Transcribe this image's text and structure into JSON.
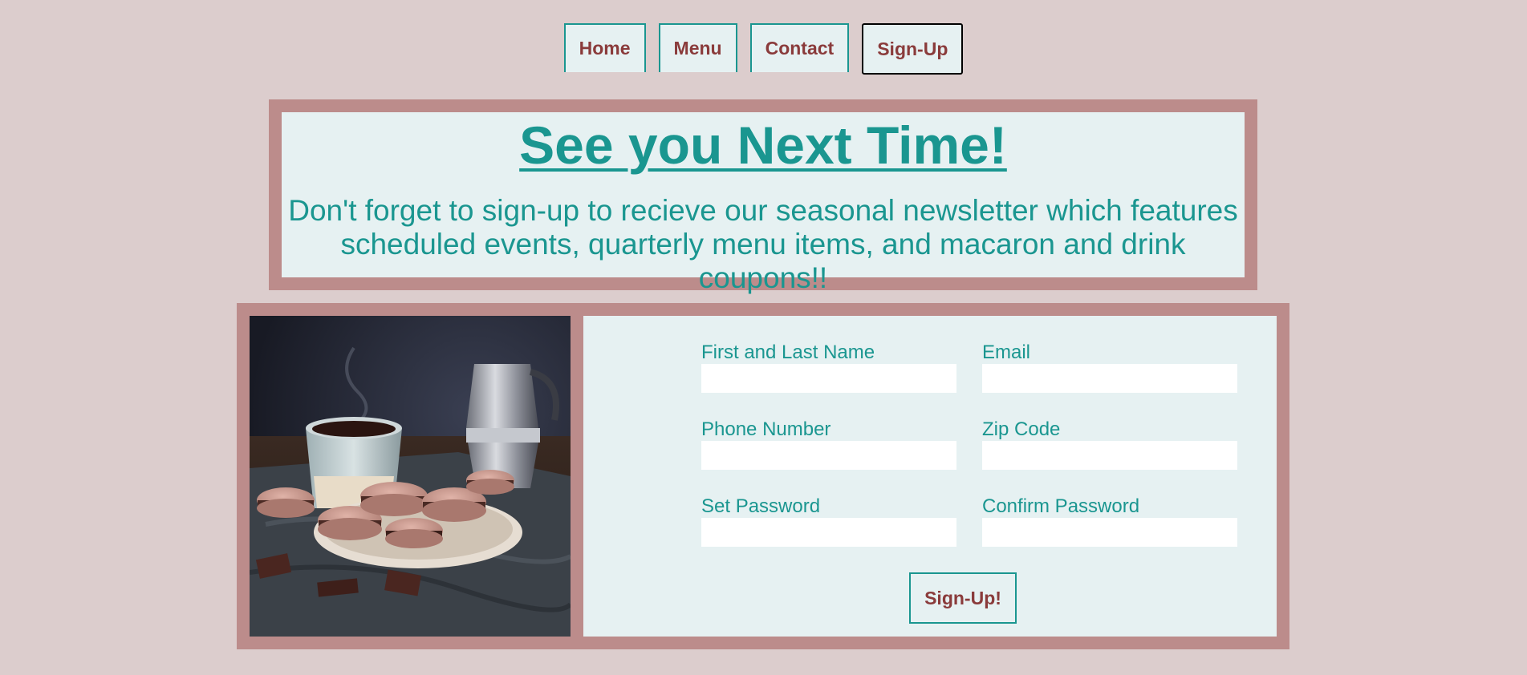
{
  "nav": {
    "items": [
      {
        "label": "Home",
        "active": false
      },
      {
        "label": "Menu",
        "active": false
      },
      {
        "label": "Contact",
        "active": false
      },
      {
        "label": "Sign-Up",
        "active": true
      }
    ]
  },
  "hero": {
    "title": "See you Next Time!",
    "text": "Don't forget to sign-up to recieve our seasonal newsletter which features scheduled events, quarterly menu items, and macaron and drink coupons!!"
  },
  "photo": {
    "icon": "macarons-coffee-photo"
  },
  "form": {
    "fields": [
      {
        "label": "First and Last Name",
        "value": "",
        "placeholder": ""
      },
      {
        "label": "Email",
        "value": "",
        "placeholder": ""
      },
      {
        "label": "Phone Number",
        "value": "",
        "placeholder": ""
      },
      {
        "label": "Zip Code",
        "value": "",
        "placeholder": ""
      },
      {
        "label": "Set Password",
        "value": "",
        "placeholder": ""
      },
      {
        "label": "Confirm Password",
        "value": "",
        "placeholder": ""
      }
    ],
    "submit_label": "Sign-Up!"
  },
  "colors": {
    "background": "#dccdcd",
    "frame": "#bc8c8b",
    "panel": "#e6f1f2",
    "teal": "#1a9690",
    "maroon": "#8a3b3b"
  }
}
